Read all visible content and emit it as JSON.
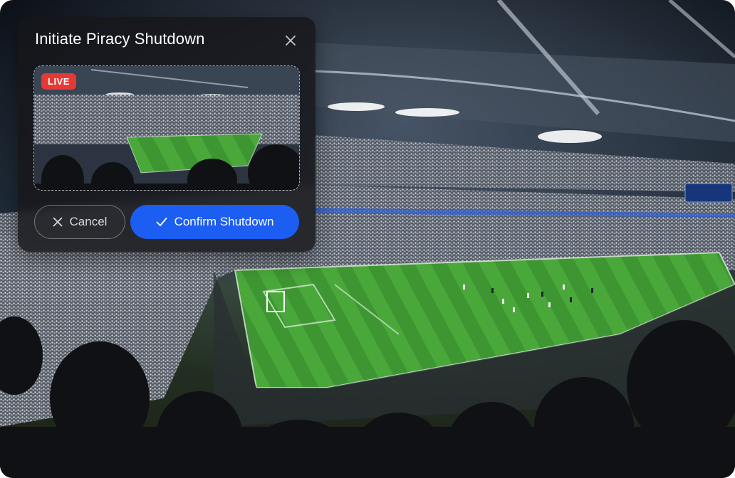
{
  "dialog": {
    "title": "Initiate Piracy Shutdown",
    "close_icon": "close-icon",
    "preview": {
      "badge": "LIVE"
    },
    "actions": {
      "cancel_label": "Cancel",
      "cancel_icon": "x-icon",
      "confirm_label": "Confirm Shutdown",
      "confirm_icon": "checkmark-icon"
    }
  },
  "colors": {
    "accent": "#1c5df2",
    "live": "#e53935"
  }
}
